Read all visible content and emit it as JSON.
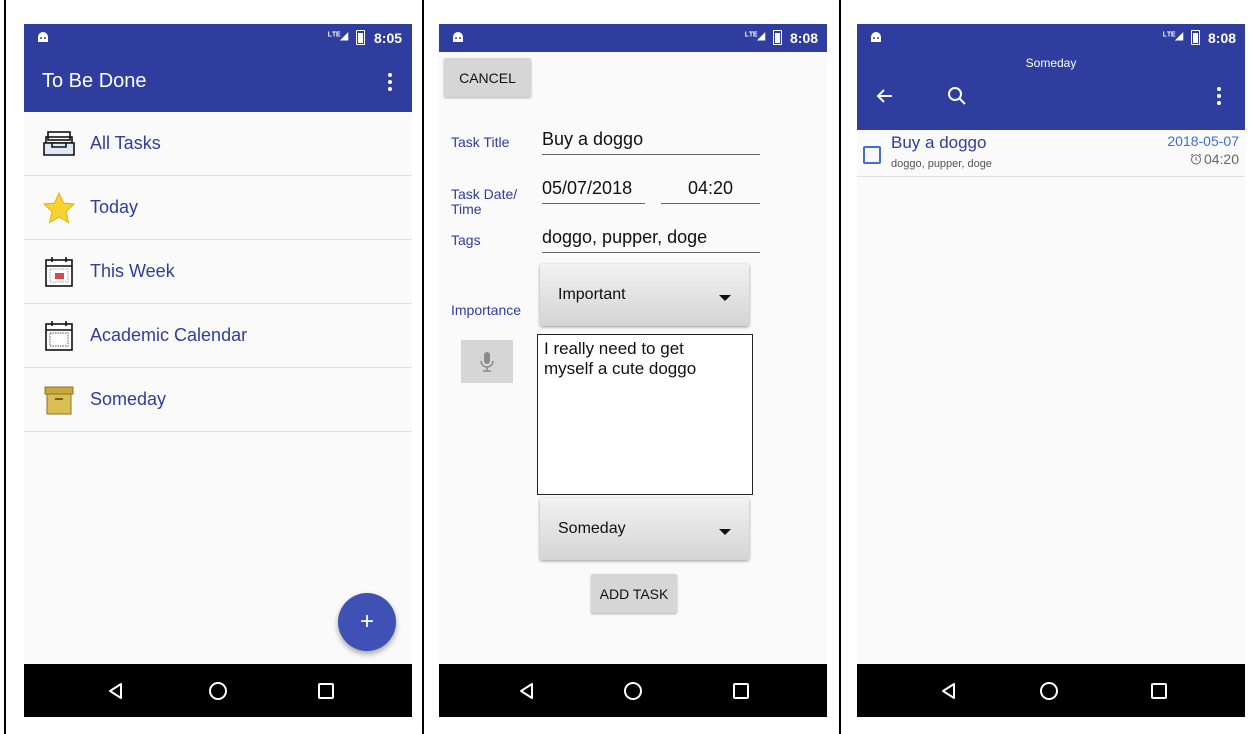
{
  "status": {
    "time1": "8:05",
    "time2": "8:08",
    "time3": "8:08",
    "network": "LTE"
  },
  "screen1": {
    "app_title": "To Be Done",
    "categories": [
      {
        "label": "All Tasks",
        "icon": "inbox-tray-icon"
      },
      {
        "label": "Today",
        "icon": "star-icon"
      },
      {
        "label": "This Week",
        "icon": "week-calendar-icon"
      },
      {
        "label": "Academic Calendar",
        "icon": "month-calendar-icon"
      },
      {
        "label": "Someday",
        "icon": "archive-box-icon"
      }
    ],
    "fab_label": "+"
  },
  "screen2": {
    "cancel_label": "CANCEL",
    "task_title_label": "Task Title",
    "task_title_value": "Buy a doggo",
    "task_date_label_1": "Task Date/",
    "task_date_label_2": "Time",
    "date_value": "05/07/2018",
    "time_value": "04:20",
    "tags_label": "Tags",
    "tags_value": "doggo, pupper, doge",
    "importance_label": "Importance",
    "importance_value": "Important",
    "notes_value": "I really need to get\nmyself a cute doggo",
    "category_value": "Someday",
    "add_task_label": "ADD TASK"
  },
  "screen3": {
    "subtitle": "Someday",
    "task": {
      "title": "Buy a doggo",
      "tags": "doggo, pupper, doge",
      "date": "2018-05-07",
      "time": "04:20"
    }
  },
  "colors": {
    "primary": "#2f3d9f",
    "fab": "#3f51b5",
    "accent_blue": "#3f6fd4"
  }
}
